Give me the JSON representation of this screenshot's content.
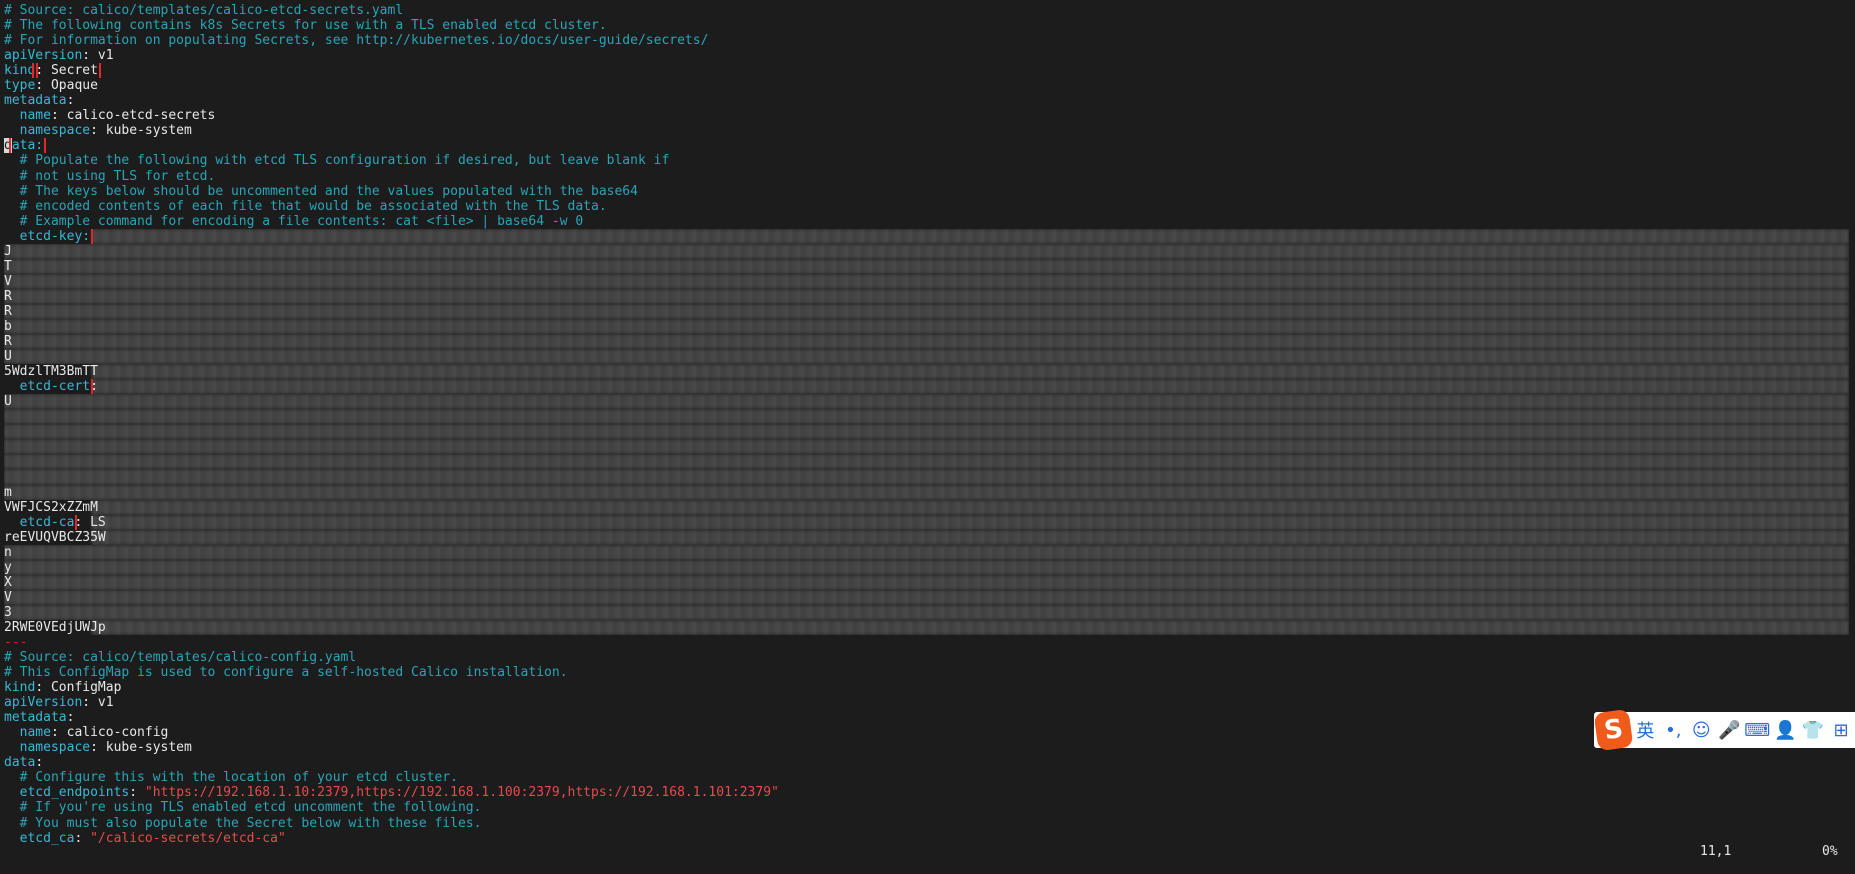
{
  "editor": {
    "lines": [
      {
        "parts": [
          {
            "t": "# Source: calico/templates/calico-etcd-secrets.yaml",
            "c": "c"
          }
        ]
      },
      {
        "parts": [
          {
            "t": "# The following contains k8s Secrets for use with a TLS enabled etcd cluster.",
            "c": "c"
          }
        ]
      },
      {
        "parts": [
          {
            "t": "# For information on populating Secrets, see http://kubernetes.io/docs/user-guide/secrets/",
            "c": "c"
          }
        ]
      },
      {
        "parts": [
          {
            "t": "apiVersion",
            "c": "k"
          },
          {
            "t": ": v1",
            "c": "v"
          }
        ]
      },
      {
        "parts": [
          {
            "t": "kind",
            "c": "k",
            "box": true
          },
          {
            "t": ": Secret",
            "c": "v",
            "box": true
          }
        ]
      },
      {
        "parts": [
          {
            "t": "type",
            "c": "k"
          },
          {
            "t": ": Opaque",
            "c": "v"
          }
        ]
      },
      {
        "parts": [
          {
            "t": "metadata",
            "c": "k"
          },
          {
            "t": ":",
            "c": "v"
          }
        ]
      },
      {
        "parts": [
          {
            "t": "  name",
            "c": "k"
          },
          {
            "t": ": calico-etcd-secrets",
            "c": "v"
          }
        ]
      },
      {
        "parts": [
          {
            "t": "  namespace",
            "c": "k"
          },
          {
            "t": ": kube-system",
            "c": "v"
          }
        ]
      },
      {
        "parts": [
          {
            "t": "d",
            "c": "cursor"
          },
          {
            "t": "ata:",
            "c": "k",
            "box": true
          }
        ]
      },
      {
        "parts": [
          {
            "t": "  # Populate the following with etcd TLS configuration if desired, but leave blank if",
            "c": "c"
          }
        ]
      },
      {
        "parts": [
          {
            "t": "  # not using TLS for etcd.",
            "c": "c"
          }
        ]
      },
      {
        "parts": [
          {
            "t": "  # The keys below should be uncommented and the values populated with the base64",
            "c": "c"
          }
        ]
      },
      {
        "parts": [
          {
            "t": "  # encoded contents of each file that would be associated with the TLS data.",
            "c": "c"
          }
        ]
      },
      {
        "parts": [
          {
            "t": "  # Example command for encoding a file contents: cat <file> | base64 -w 0",
            "c": "c"
          }
        ]
      },
      {
        "parts": [
          {
            "t": "  etcd-key:",
            "c": "k",
            "box": true
          }
        ],
        "blur": "wide"
      },
      {
        "parts": [
          {
            "t": "J",
            "c": "v"
          }
        ],
        "blur": "full"
      },
      {
        "parts": [
          {
            "t": "T",
            "c": "v"
          }
        ],
        "blur": "full"
      },
      {
        "parts": [
          {
            "t": "V",
            "c": "v"
          }
        ],
        "blur": "full"
      },
      {
        "parts": [
          {
            "t": "R",
            "c": "v"
          }
        ],
        "blur": "full"
      },
      {
        "parts": [
          {
            "t": "R",
            "c": "v"
          }
        ],
        "blur": "full"
      },
      {
        "parts": [
          {
            "t": "b",
            "c": "v"
          }
        ],
        "blur": "full"
      },
      {
        "parts": [
          {
            "t": "R",
            "c": "v"
          }
        ],
        "blur": "full"
      },
      {
        "parts": [
          {
            "t": "U",
            "c": "v"
          }
        ],
        "blur": "full"
      },
      {
        "parts": [
          {
            "t": "5WdzlTM3BmTT",
            "c": "v"
          }
        ],
        "blur": "wide"
      },
      {
        "parts": [
          {
            "t": "  etcd-cert",
            "c": "k",
            "box": true
          },
          {
            "t": ":",
            "c": "v"
          }
        ],
        "blur": "wide"
      },
      {
        "parts": [
          {
            "t": "U",
            "c": "v"
          }
        ],
        "blur": "full"
      },
      {
        "parts": [
          {
            "t": "",
            "c": "v"
          }
        ],
        "blur": "full"
      },
      {
        "parts": [
          {
            "t": "",
            "c": "v"
          }
        ],
        "blur": "full"
      },
      {
        "parts": [
          {
            "t": "",
            "c": "v"
          }
        ],
        "blur": "full"
      },
      {
        "parts": [
          {
            "t": "",
            "c": "v"
          }
        ],
        "blur": "full"
      },
      {
        "parts": [
          {
            "t": "",
            "c": "v"
          }
        ],
        "blur": "full"
      },
      {
        "parts": [
          {
            "t": "m",
            "c": "v"
          }
        ],
        "blur": "full"
      },
      {
        "parts": [
          {
            "t": "VWFJCS2xZZmM",
            "c": "v"
          }
        ],
        "blur": "wide"
      },
      {
        "parts": [
          {
            "t": "  etcd-ca",
            "c": "k",
            "box": true
          },
          {
            "t": ": LS",
            "c": "v"
          }
        ],
        "blur": "wide"
      },
      {
        "parts": [
          {
            "t": "reEVUQVBCZ35W",
            "c": "v"
          }
        ],
        "blur": "wide"
      },
      {
        "parts": [
          {
            "t": "n",
            "c": "v"
          }
        ],
        "blur": "full"
      },
      {
        "parts": [
          {
            "t": "y",
            "c": "v"
          }
        ],
        "blur": "full"
      },
      {
        "parts": [
          {
            "t": "X",
            "c": "v"
          }
        ],
        "blur": "full"
      },
      {
        "parts": [
          {
            "t": "V",
            "c": "v"
          }
        ],
        "blur": "full"
      },
      {
        "parts": [
          {
            "t": "3",
            "c": "v"
          }
        ],
        "blur": "full"
      },
      {
        "parts": [
          {
            "t": "2RWE0VEdjUWJp",
            "c": "v"
          }
        ],
        "blur": "wide"
      },
      {
        "parts": [
          {
            "t": "---",
            "c": "d"
          }
        ]
      },
      {
        "parts": [
          {
            "t": "# Source: calico/templates/calico-config.yaml",
            "c": "c"
          }
        ]
      },
      {
        "parts": [
          {
            "t": "# This ConfigMap is used to configure a self-hosted Calico installation.",
            "c": "c"
          }
        ]
      },
      {
        "parts": [
          {
            "t": "kind",
            "c": "k"
          },
          {
            "t": ": ConfigMap",
            "c": "v"
          }
        ]
      },
      {
        "parts": [
          {
            "t": "apiVersion",
            "c": "k"
          },
          {
            "t": ": v1",
            "c": "v"
          }
        ]
      },
      {
        "parts": [
          {
            "t": "metadata",
            "c": "k"
          },
          {
            "t": ":",
            "c": "v"
          }
        ]
      },
      {
        "parts": [
          {
            "t": "  name",
            "c": "k"
          },
          {
            "t": ": calico-config",
            "c": "v"
          }
        ]
      },
      {
        "parts": [
          {
            "t": "  namespace",
            "c": "k"
          },
          {
            "t": ": kube-system",
            "c": "v"
          }
        ]
      },
      {
        "parts": [
          {
            "t": "data",
            "c": "k"
          },
          {
            "t": ":",
            "c": "v"
          }
        ]
      },
      {
        "parts": [
          {
            "t": "  # Configure this with the location of your etcd cluster.",
            "c": "c"
          }
        ]
      },
      {
        "parts": [
          {
            "t": "  etcd_endpoints",
            "c": "k"
          },
          {
            "t": ": ",
            "c": "v"
          },
          {
            "t": "\"https://192.168.1.10:2379,https://192.168.1.100:2379,https://192.168.1.101:2379\"",
            "c": "s"
          }
        ]
      },
      {
        "parts": [
          {
            "t": "  # If you're using TLS enabled etcd uncomment the following.",
            "c": "c"
          }
        ]
      },
      {
        "parts": [
          {
            "t": "  # You must also populate the Secret below with these files.",
            "c": "c"
          }
        ]
      },
      {
        "parts": [
          {
            "t": "  etcd_ca",
            "c": "k"
          },
          {
            "t": ": ",
            "c": "v"
          },
          {
            "t": "\"/calico-secrets/etcd-ca\"",
            "c": "s"
          }
        ]
      }
    ]
  },
  "status": {
    "position": "11,1",
    "percent": "0%"
  },
  "ime": {
    "logo": "S",
    "lang": "英",
    "items": [
      "•,",
      "☺",
      "🎤",
      "⌨",
      "👤",
      "👕",
      "⊞"
    ]
  }
}
